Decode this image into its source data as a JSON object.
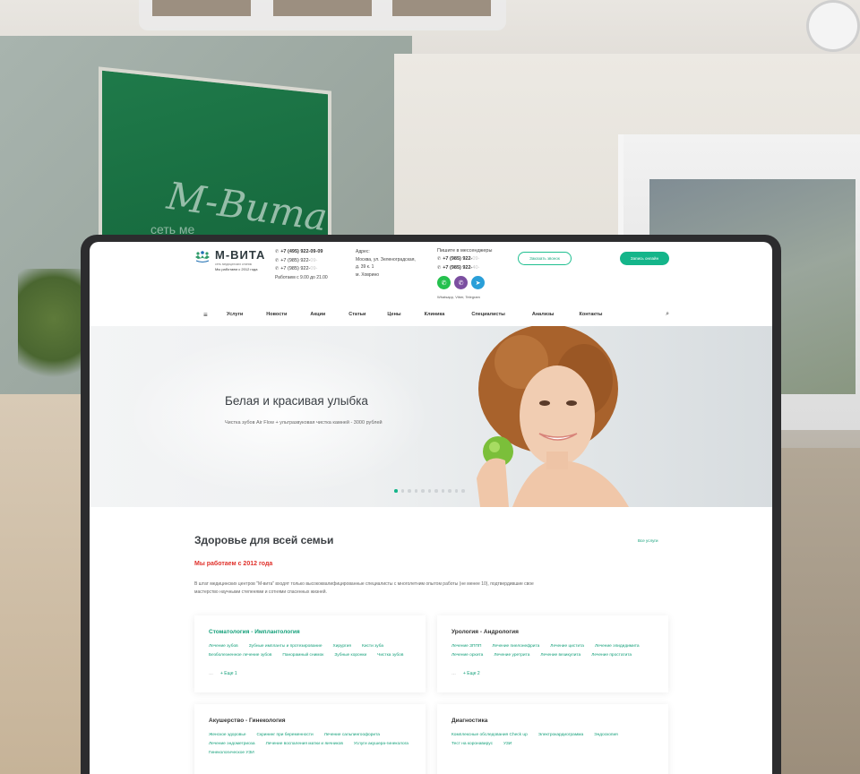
{
  "background": {
    "sign_text": "М-Вита",
    "sign_sub": "сеть ме"
  },
  "site": {
    "logo": {
      "name": "М-ВИТА",
      "tagline": "сеть медицинских клиник",
      "since": "Мы работаем с 2012 года"
    },
    "phones": {
      "items": [
        {
          "prefix": "+7 (495) 922-09-09",
          "mask": ""
        },
        {
          "prefix": "+7 (985) 922-",
          "mask": "09-"
        },
        {
          "prefix": "+7 (985) 922-",
          "mask": "09-"
        }
      ],
      "hours": "Работаем с 9.00 до 21.00"
    },
    "address": {
      "label": "Адрес:",
      "line1": "Москва, ул. Зеленоградская,",
      "line2": "д. 39 к. 1",
      "line3": "м. Ховрино"
    },
    "messengers": {
      "title": "Пишите в мессенджеры",
      "phones": [
        {
          "prefix": "+7 (985) 922-",
          "mask": "09-"
        },
        {
          "prefix": "+7 (985) 922-",
          "mask": "40-"
        }
      ],
      "note": "Whatsapp, Viber, Telegram"
    },
    "buttons": {
      "call": "Заказать звонок",
      "book": "Запись онлайн"
    },
    "nav": [
      "Услуги",
      "Новости",
      "Акции",
      "Статьи",
      "Цены",
      "Клиника",
      "Специалисты",
      "Анализы",
      "Контакты"
    ],
    "hero": {
      "title": "Белая и красивая улыбка",
      "subtitle": "Чистка зубов Air Flow + ультразвуковая чистка камней - 3000 рублей",
      "slides": 11,
      "active_slide": 1
    },
    "section": {
      "title": "Здоровье для всей семьи",
      "all_link": "Все услуги",
      "since": "Мы работаем с 2012 года",
      "text": "В штат медицинских центров \"М-вита\" входят только высококвалифицированные специалисты с многолетним опытом работы (не менее 10), подтвердившие свое мастерство научными степенями и сотнями спасенных жизней."
    },
    "cards": [
      {
        "title": "Стоматология - Имплантология",
        "links": [
          "Лечение зубов",
          "Зубные импланты и протезирование",
          "Хирургия",
          "Кисти зуба",
          "Безболезненное лечение зубов",
          "Панорамный снимок",
          "Зубные коронки",
          "Чистка зубов"
        ],
        "more": "+ Еще 1"
      },
      {
        "title": "Урология - Андрология",
        "links": [
          "Лечение ЗППП",
          "Лечение пиелонефрита",
          "Лечение цистита",
          "Лечение эпидидимита",
          "Лечение орхита",
          "Лечение уретрита",
          "Лечение везикулита",
          "Лечение простатита"
        ],
        "more": "+ Еще 2"
      },
      {
        "title": "Акушерство - Гинекология",
        "links": [
          "Женское здоровье",
          "Скрининг при беременности",
          "Лечение сальпингоофорита",
          "Лечение эндометриоза",
          "Лечение воспаления матки и яичников",
          "Услуги акушера-гинеколога",
          "Гинекологическое УЗИ"
        ]
      },
      {
        "title": "Диагностика",
        "links": [
          "Комплексные обследования Check up",
          "Электрокардиограмма",
          "Эндоскопия",
          "Тест на коронавирус",
          "УЗИ"
        ]
      }
    ]
  }
}
